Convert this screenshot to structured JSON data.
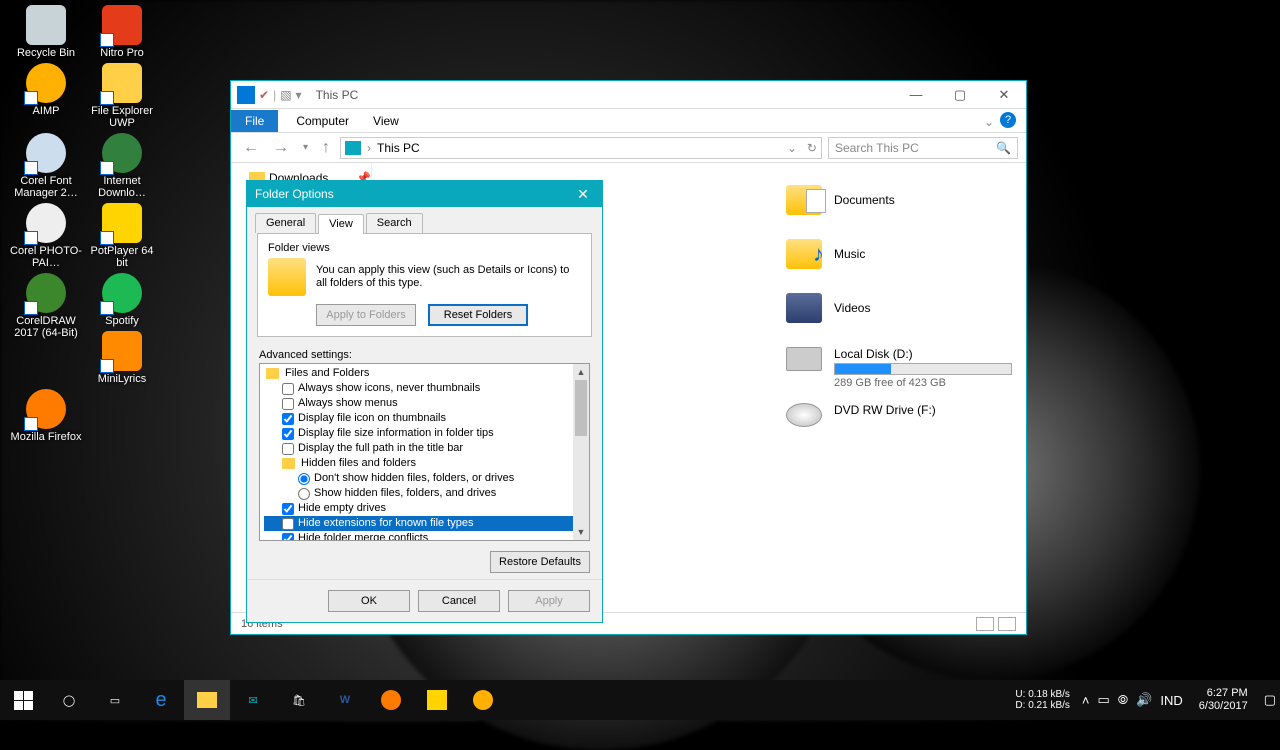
{
  "desktop": {
    "icons": [
      {
        "name": "recycle-bin",
        "label": "Recycle Bin",
        "color": "#8aa"
      },
      {
        "name": "nitro-pro",
        "label": "Nitro Pro",
        "color": "#e43b1a"
      },
      {
        "name": "aimp",
        "label": "AIMP",
        "color": "#ffb000"
      },
      {
        "name": "file-explorer-uwp",
        "label": "File Explorer UWP",
        "color": "#ffcf48"
      },
      {
        "name": "corel-font-manager",
        "label": "Corel Font Manager 2…",
        "color": "#cde"
      },
      {
        "name": "internet-download",
        "label": "Internet Downlo…",
        "color": "#4b7"
      },
      {
        "name": "corel-photo-paint",
        "label": "Corel PHOTO-PAI…",
        "color": "#ddd"
      },
      {
        "name": "potplayer",
        "label": "PotPlayer 64 bit",
        "color": "#ffd400"
      },
      {
        "name": "coreldraw",
        "label": "CorelDRAW 2017 (64-Bit)",
        "color": "#3c862b"
      },
      {
        "name": "spotify",
        "label": "Spotify",
        "color": "#1db954"
      },
      {
        "name": "minilyrics",
        "label": "MiniLyrics",
        "color": "#ff8a00"
      },
      {
        "name": "mozilla-firefox",
        "label": "Mozilla Firefox",
        "color": "#ff7b00"
      }
    ]
  },
  "explorer": {
    "title": "This PC",
    "tabs": {
      "file": "File",
      "computer": "Computer",
      "view": "View"
    },
    "breadcrumb": "This PC",
    "search_placeholder": "Search This PC",
    "nav": {
      "downloads": "Downloads"
    },
    "folders": {
      "documents": "Documents",
      "music": "Music",
      "videos": "Videos"
    },
    "drives": {
      "d": {
        "label": "Local Disk (D:)",
        "free": "289 GB free of 423 GB",
        "fill_pct": 32
      },
      "f": {
        "label": "DVD RW Drive (F:)"
      }
    },
    "status": "16 items"
  },
  "dialog": {
    "title": "Folder Options",
    "tabs": {
      "general": "General",
      "view": "View",
      "search": "Search"
    },
    "folder_views_label": "Folder views",
    "folder_views_text": "You can apply this view (such as Details or Icons) to all folders of this type.",
    "apply_to_folders": "Apply to Folders",
    "reset_folders": "Reset Folders",
    "advanced_label": "Advanced settings:",
    "tree": {
      "files_and_folders": "Files and Folders",
      "always_icons": "Always show icons, never thumbnails",
      "always_menus": "Always show menus",
      "file_icon_thumb": "Display file icon on thumbnails",
      "file_size_tips": "Display file size information in folder tips",
      "full_path_title": "Display the full path in the title bar",
      "hidden_header": "Hidden files and folders",
      "dont_show_hidden": "Don't show hidden files, folders, or drives",
      "show_hidden": "Show hidden files, folders, and drives",
      "hide_empty": "Hide empty drives",
      "hide_ext": "Hide extensions for known file types",
      "hide_merge": "Hide folder merge conflicts"
    },
    "restore_defaults": "Restore Defaults",
    "ok": "OK",
    "cancel": "Cancel",
    "apply": "Apply"
  },
  "taskbar": {
    "net_up": "U:    0.18 kB/s",
    "net_down": "D:    0.21 kB/s",
    "lang": "IND",
    "time": "6:27 PM",
    "date": "6/30/2017"
  }
}
